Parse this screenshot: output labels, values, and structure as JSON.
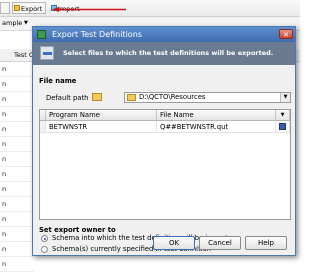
{
  "background": {
    "toolbar": {
      "export_label": "Export ...",
      "import_label": "Import"
    },
    "row2_label": "ample",
    "col_header": "Test O",
    "list_items": [
      "n",
      "n",
      "n",
      "n",
      "n",
      "n",
      "n",
      "n",
      "n",
      "n",
      "n",
      "n",
      "n",
      "n"
    ]
  },
  "dialog": {
    "title": "Export Test Definitions",
    "close_glyph": "✕",
    "banner_text": "Select files to which the test definitions will be exported.",
    "file_name_section": "File name",
    "default_path_label": "Default path",
    "default_path_value": "D:\\QCTO\\Resources",
    "table": {
      "columns": [
        "Program Name",
        "File Name"
      ],
      "rows": [
        {
          "program": "BETWNSTR",
          "file": "Q##BETWNSTR.qut"
        }
      ]
    },
    "owner_section": "Set export owner to",
    "options": [
      {
        "label": "Schema into which the test definition will be import",
        "selected": true
      },
      {
        "label": "Schema(s) currently specified in test definition",
        "selected": false
      }
    ],
    "buttons": {
      "ok": "OK",
      "cancel": "Cancel",
      "help": "Help"
    }
  },
  "colors": {
    "title_bar": "#4a78b6",
    "banner": "#6a7a90",
    "arrow": "#d01010"
  }
}
